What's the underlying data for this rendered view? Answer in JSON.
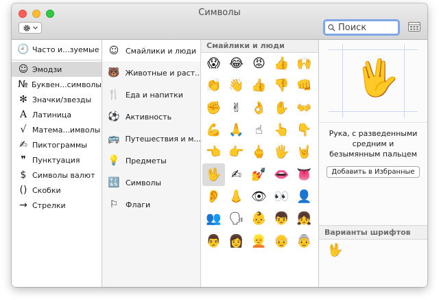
{
  "window": {
    "title": "Символы"
  },
  "toolbar": {
    "gear_icon": "gear-icon",
    "search_placeholder": "Поиск"
  },
  "categories": [
    {
      "label": "Часто и...зуемые",
      "icon": "🕘"
    },
    {
      "label": "Эмодзи",
      "icon": "☺"
    },
    {
      "label": "Буквен...символы",
      "icon": "№"
    },
    {
      "label": "Значки/звезды",
      "icon": "✻"
    },
    {
      "label": "Латиница",
      "icon": "A"
    },
    {
      "label": "Матема...имволы",
      "icon": "√"
    },
    {
      "label": "Пиктограммы",
      "icon": "✍"
    },
    {
      "label": "Пунктуация",
      "icon": "❞"
    },
    {
      "label": "Символы валют",
      "icon": "$"
    },
    {
      "label": "Скобки",
      "icon": "()"
    },
    {
      "label": "Стрелки",
      "icon": "→"
    }
  ],
  "subcategories": [
    {
      "label": "Смайлики и люди",
      "icon": "☺"
    },
    {
      "label": "Животные и раст...",
      "icon": "🐻"
    },
    {
      "label": "Еда и напитки",
      "icon": "🍴"
    },
    {
      "label": "Активность",
      "icon": "⚽"
    },
    {
      "label": "Путешествия и м...",
      "icon": "🚌"
    },
    {
      "label": "Предметы",
      "icon": "💡"
    },
    {
      "label": "Символы",
      "icon": "🔣"
    },
    {
      "label": "Флаги",
      "icon": "⚐"
    }
  ],
  "emoji_panel": {
    "header": "Смайлики и люди",
    "emojis": [
      "😱",
      "😂",
      "😡",
      "👍",
      "🙌",
      "👏",
      "👋",
      "👍",
      "👎",
      "👊",
      "✊",
      "✌",
      "👌",
      "✋",
      "👐",
      "💪",
      "🙏",
      "☝",
      "👆",
      "👇",
      "👈",
      "👉",
      "🖕",
      "🖐",
      "🤘",
      "🖖",
      "✍",
      "💅",
      "👄",
      "👅",
      "👂",
      "👃",
      "👁",
      "👀",
      "👤",
      "👥",
      "🗣",
      "👶",
      "👦",
      "👧",
      "👨",
      "👩",
      "👱",
      "👴",
      "👵"
    ]
  },
  "detail": {
    "emoji": "🖖",
    "description": "Рука, с разведенными средним и безымянным пальцем",
    "add_favorites_label": "Добавить в Избранные",
    "variants_header": "Варианты шрифтов",
    "variant_emoji": "🖖"
  }
}
